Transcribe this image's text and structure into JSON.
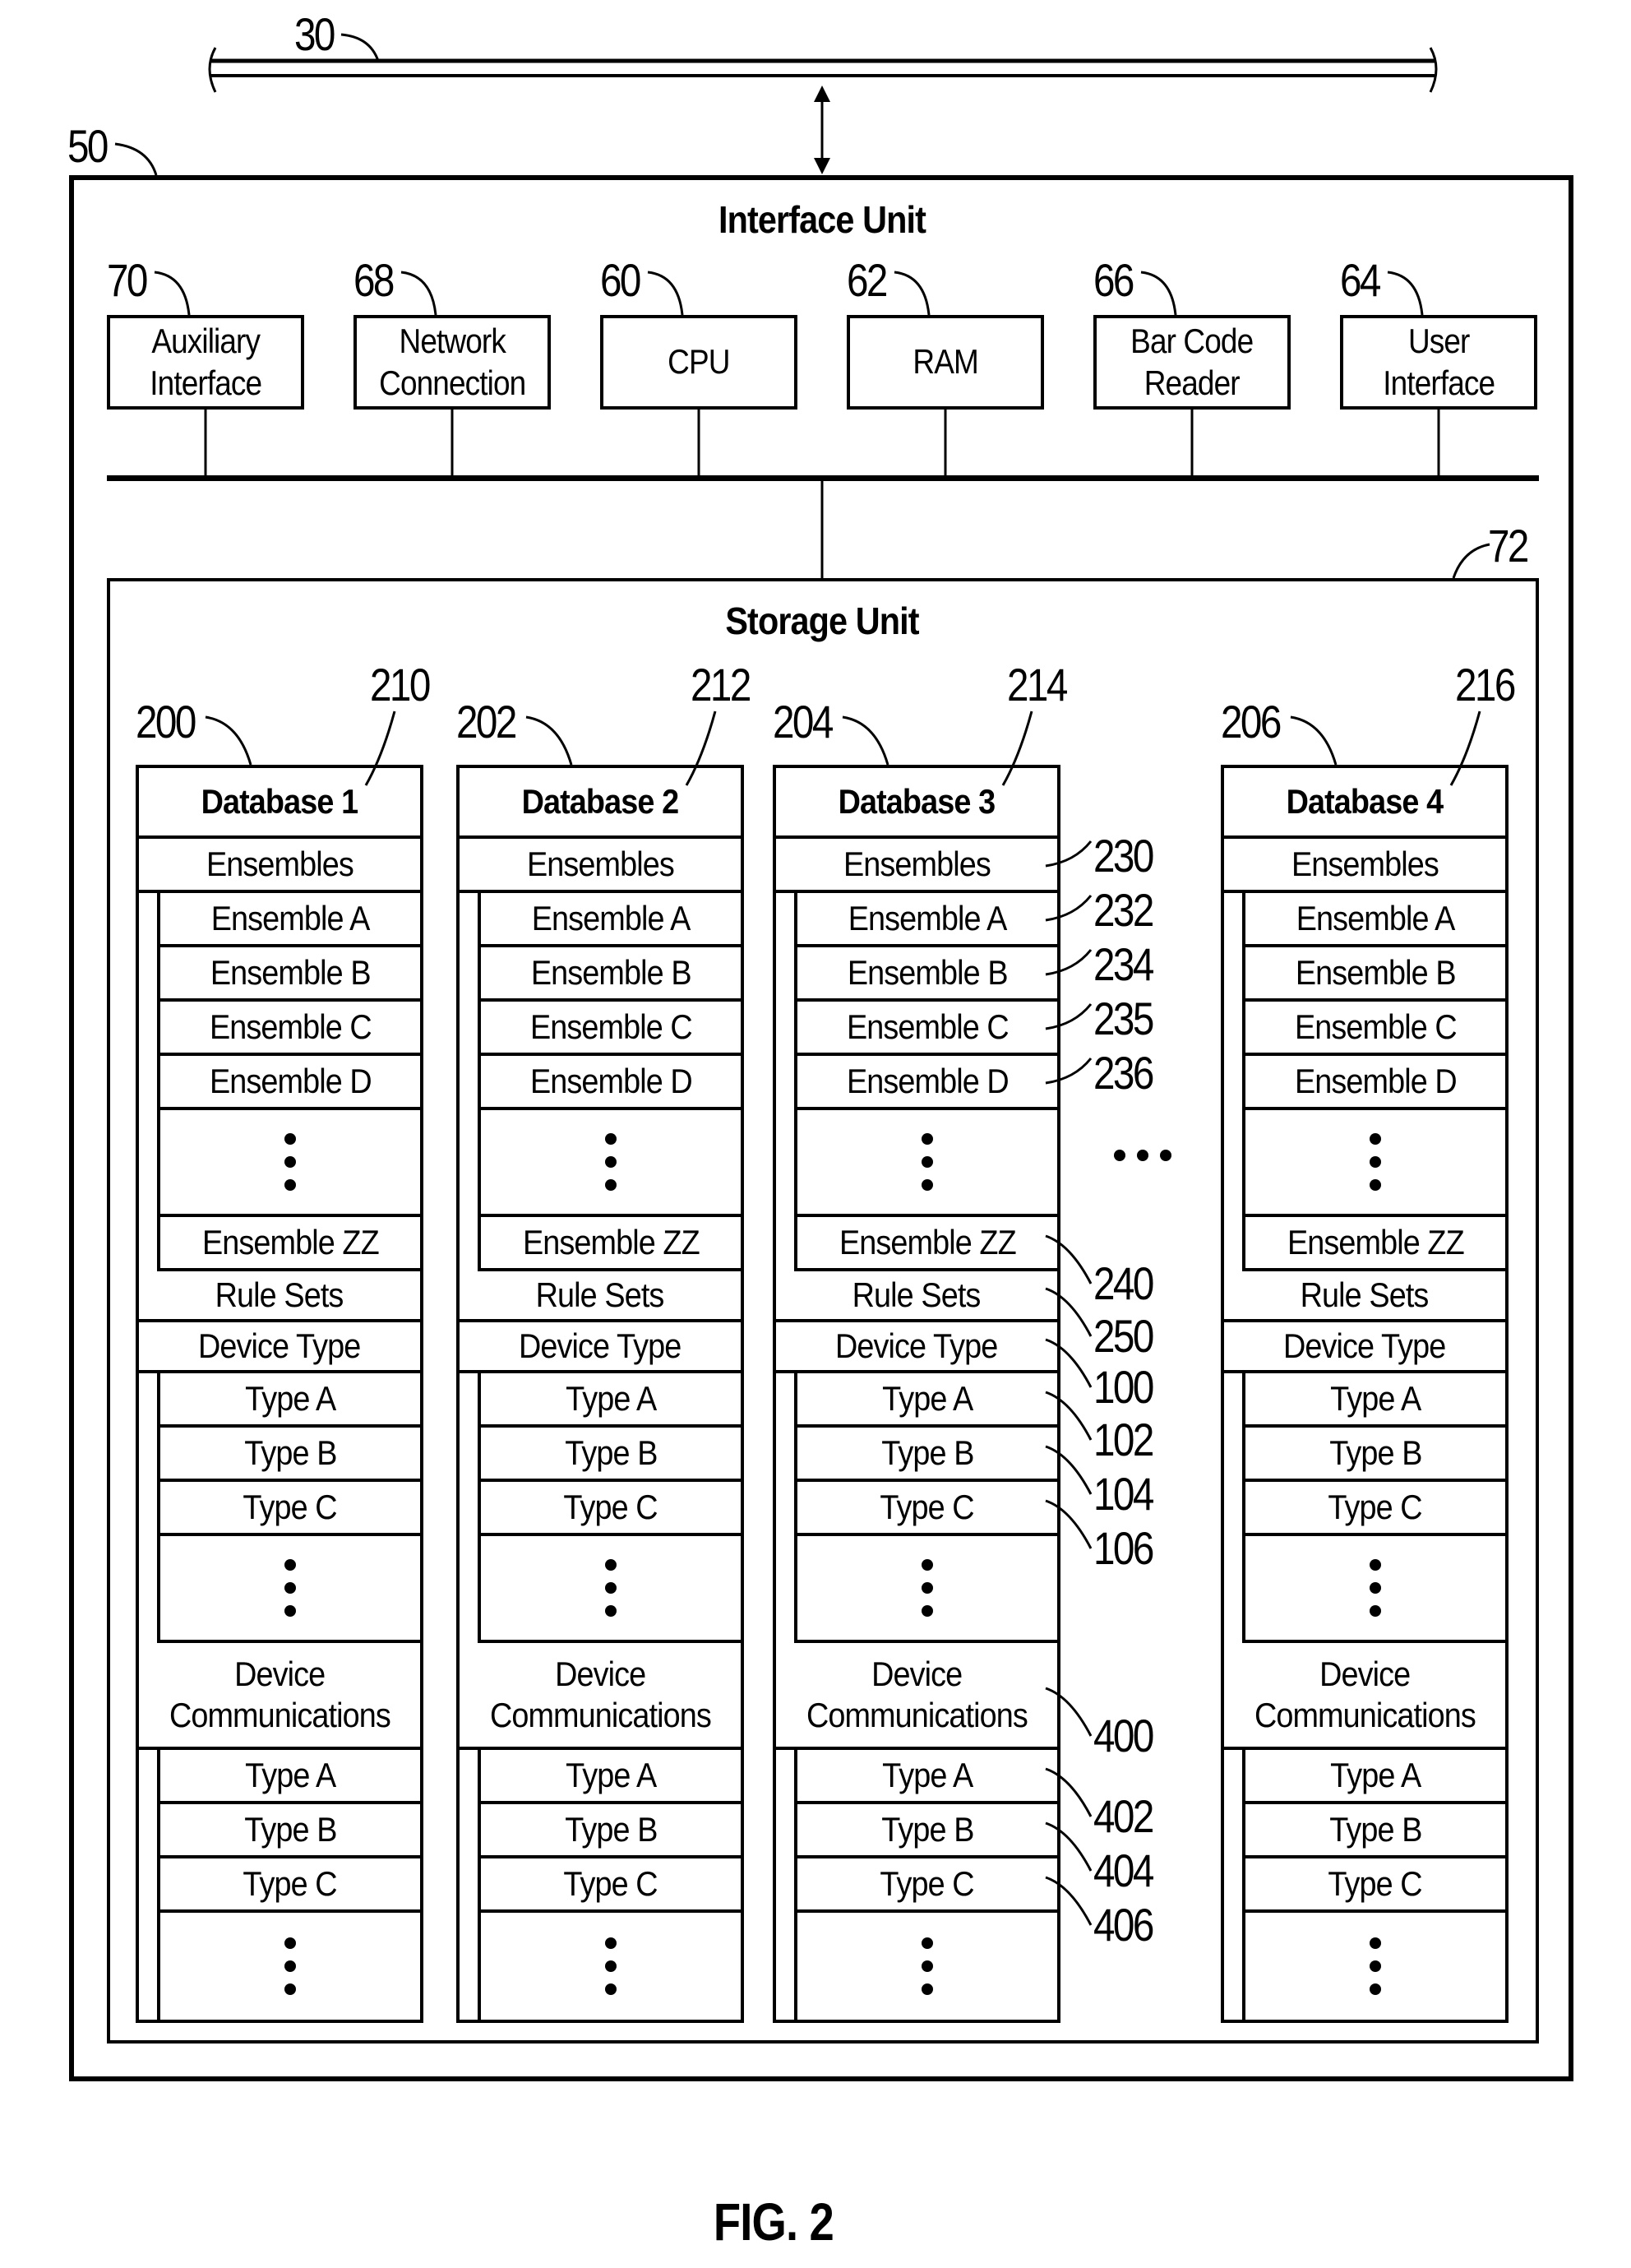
{
  "figure_label": "FIG. 2",
  "network": {
    "ref": "30"
  },
  "interface_unit": {
    "ref": "50",
    "title": "Interface Unit",
    "components": [
      {
        "ref": "70",
        "label_lines": [
          "Auxiliary",
          "Interface"
        ]
      },
      {
        "ref": "68",
        "label_lines": [
          "Network",
          "Connection"
        ]
      },
      {
        "ref": "60",
        "label_lines": [
          "CPU"
        ]
      },
      {
        "ref": "62",
        "label_lines": [
          "RAM"
        ]
      },
      {
        "ref": "66",
        "label_lines": [
          "Bar Code",
          "Reader"
        ]
      },
      {
        "ref": "64",
        "label_lines": [
          "User",
          "Interface"
        ]
      }
    ]
  },
  "storage_unit": {
    "ref": "72",
    "title": "Storage Unit",
    "ellipsis": "...",
    "databases": [
      {
        "ref": "200",
        "name_ref": "210",
        "name": "Database 1"
      },
      {
        "ref": "202",
        "name_ref": "212",
        "name": "Database 2"
      },
      {
        "ref": "204",
        "name_ref": "214",
        "name": "Database 3"
      },
      {
        "ref": "206",
        "name_ref": "216",
        "name": "Database 4"
      }
    ],
    "rows": {
      "ensembles": "Ensembles",
      "ensemble_items": [
        "Ensemble A",
        "Ensemble B",
        "Ensemble C",
        "Ensemble D"
      ],
      "ensemble_last": "Ensemble ZZ",
      "rule_sets": "Rule Sets",
      "device_type": "Device Type",
      "device_type_items": [
        "Type A",
        "Type B",
        "Type C"
      ],
      "device_comms_lines": [
        "Device",
        "Communications"
      ],
      "device_comms_items": [
        "Type A",
        "Type B",
        "Type C"
      ]
    },
    "database3_callouts": {
      "ensembles": "230",
      "ensemble_items": [
        "232",
        "234",
        "235",
        "236"
      ],
      "ensemble_last": "240",
      "rule_sets": "250",
      "device_type": "100",
      "device_type_items": [
        "102",
        "104",
        "106"
      ],
      "device_comms": "400",
      "device_comms_items": [
        "402",
        "404",
        "406"
      ]
    }
  }
}
